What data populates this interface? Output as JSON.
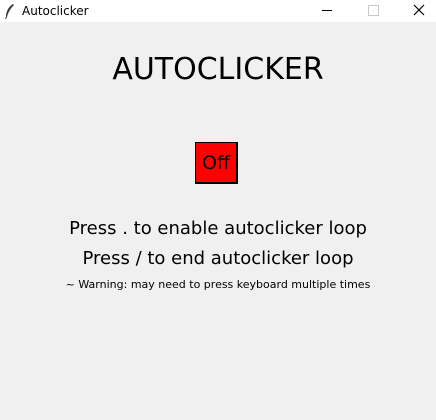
{
  "window": {
    "title": "Autoclicker",
    "icon": "feather-icon"
  },
  "controls": {
    "minimize_icon": "minimize-icon",
    "maximize_icon": "maximize-icon",
    "close_icon": "close-icon"
  },
  "main": {
    "heading": "AUTOCLICKER",
    "toggle_label": "Off",
    "toggle_color": "#ff0000",
    "instruction_enable": "Press . to enable autoclicker loop",
    "instruction_end": "Press / to end autoclicker loop",
    "warning": "~ Warning: may need to press keyboard multiple times"
  }
}
